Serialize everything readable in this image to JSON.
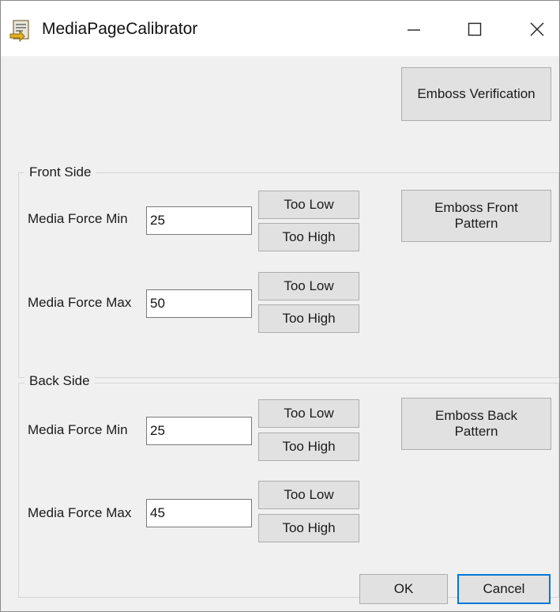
{
  "window": {
    "title": "MediaPageCalibrator",
    "controls": {
      "minimize": "minimize",
      "maximize": "maximize",
      "close": "close"
    }
  },
  "verify_button": "Emboss Verification",
  "front": {
    "group_label": "Front Side",
    "min_label": "Media Force Min",
    "min_value": "25",
    "max_label": "Media Force Max",
    "max_value": "50",
    "too_low": "Too Low",
    "too_high": "Too High",
    "emboss_button": "Emboss Front\nPattern"
  },
  "back": {
    "group_label": "Back Side",
    "min_label": "Media Force Min",
    "min_value": "25",
    "max_label": "Media Force Max",
    "max_value": "45",
    "too_low": "Too Low",
    "too_high": "Too High",
    "emboss_button": "Emboss Back\nPattern"
  },
  "footer": {
    "ok": "OK",
    "cancel": "Cancel"
  },
  "colors": {
    "window_bg": "#f0f0f0",
    "button_bg": "#e1e1e1",
    "default_border": "#0078d7"
  }
}
